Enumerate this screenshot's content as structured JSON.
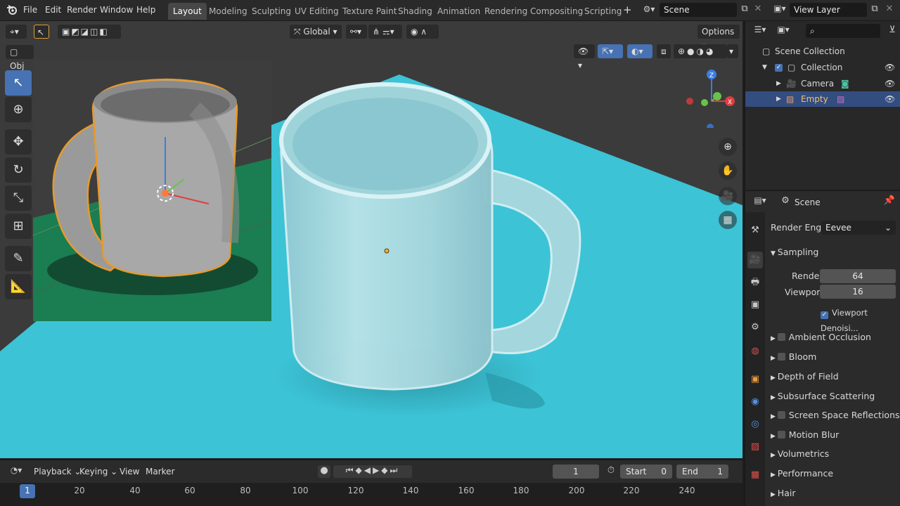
{
  "menu": [
    "File",
    "Edit",
    "Render",
    "Window",
    "Help"
  ],
  "workspaces": [
    {
      "label": "Layout",
      "active": true
    },
    {
      "label": "Modeling"
    },
    {
      "label": "Sculpting"
    },
    {
      "label": "UV Editing"
    },
    {
      "label": "Texture Paint"
    },
    {
      "label": "Shading"
    },
    {
      "label": "Animation"
    },
    {
      "label": "Rendering"
    },
    {
      "label": "Compositing"
    },
    {
      "label": "Scripting"
    }
  ],
  "add_workspace": "+",
  "scene_field": "Scene",
  "view_layer_field": "View Layer",
  "viewport": {
    "mode_label": "Obj",
    "transform_orientation": "Global",
    "options_label": "Options"
  },
  "gizmo_axes": {
    "x": "X",
    "y": "Y",
    "z": "Z"
  },
  "outliner": {
    "root": "Scene Collection",
    "collection": "Collection",
    "items": [
      "Camera",
      "Empty"
    ],
    "selected": "Empty"
  },
  "properties": {
    "context_label": "Scene",
    "render_engine_label": "Render Engi...",
    "render_engine_value": "Eevee",
    "sampling": {
      "title": "Sampling",
      "render_label": "Render",
      "render_value": "64",
      "viewport_label": "Viewport",
      "viewport_value": "16",
      "denoise_label": "Viewport Denoisi..."
    },
    "panels": [
      {
        "label": "Ambient Occlusion",
        "checkbox": true
      },
      {
        "label": "Bloom",
        "checkbox": true
      },
      {
        "label": "Depth of Field",
        "checkbox": false
      },
      {
        "label": "Subsurface Scattering",
        "checkbox": false
      },
      {
        "label": "Screen Space Reflections",
        "checkbox": true
      },
      {
        "label": "Motion Blur",
        "checkbox": true
      },
      {
        "label": "Volumetrics",
        "checkbox": false
      },
      {
        "label": "Performance",
        "checkbox": false
      },
      {
        "label": "Hair",
        "checkbox": false
      }
    ]
  },
  "timeline": {
    "menus": [
      "Playback",
      "Keying",
      "View",
      "Marker"
    ],
    "current_frame": "1",
    "start_label": "Start",
    "start_value": "0",
    "end_label": "End",
    "end_value": "1",
    "ruler_labels": [
      "1",
      "20",
      "40",
      "60",
      "80",
      "100",
      "120",
      "140",
      "160",
      "180",
      "200",
      "220",
      "240"
    ]
  },
  "colors": {
    "accent": "#4772b3",
    "floor": "#3cc3d6",
    "selection_outline": "#f0a030"
  }
}
